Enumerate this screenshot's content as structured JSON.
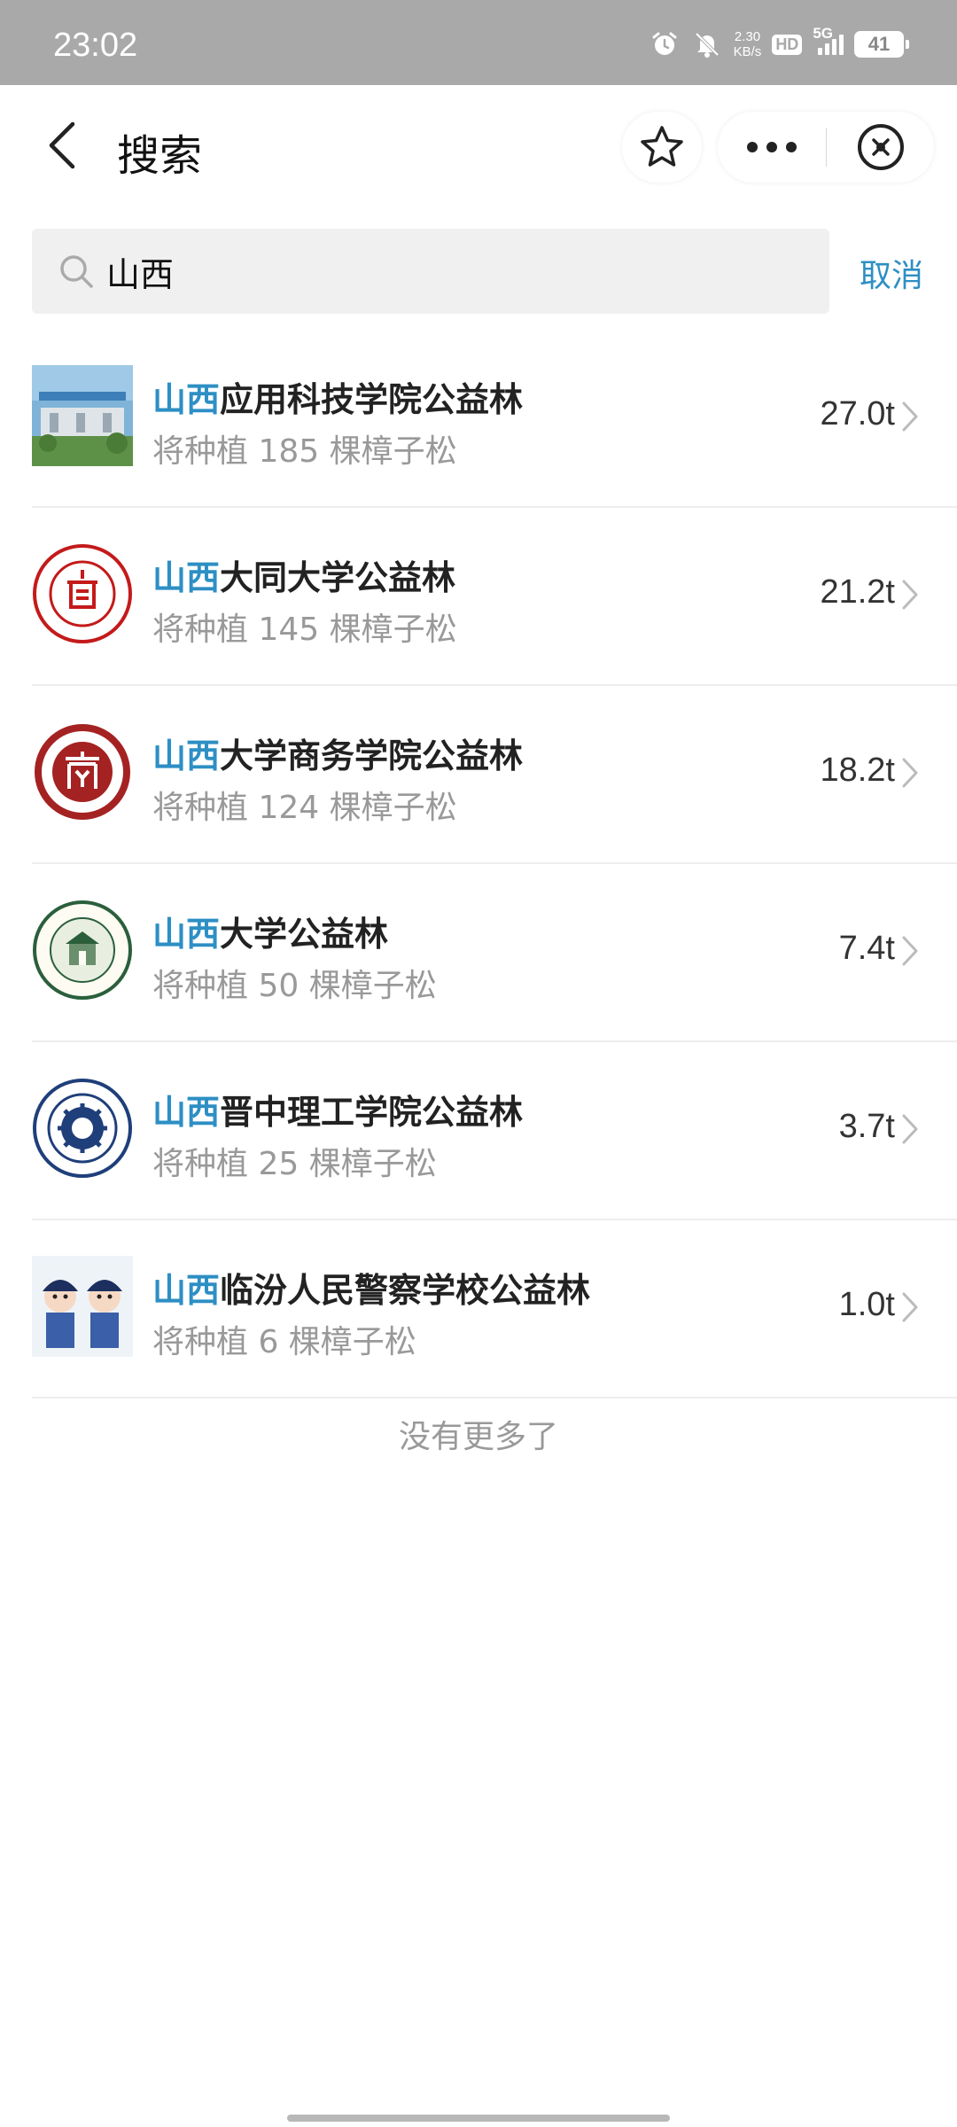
{
  "status_bar": {
    "time": "23:02",
    "net_speed_value": "2.30",
    "net_speed_unit": "KB/s",
    "hd_label": "HD",
    "network": "5G",
    "battery": "41"
  },
  "header": {
    "title": "搜索",
    "back_icon": "chevron-left-icon",
    "favorite_icon": "star-icon",
    "more_icon": "more-dots-icon",
    "close_icon": "close-circle-icon"
  },
  "search": {
    "value": "山西",
    "cancel_label": "取消"
  },
  "colors": {
    "accent": "#2d8fc4",
    "status_bar": "#a9a9a9",
    "secondary_text": "#999999"
  },
  "results": [
    {
      "highlight": "山西",
      "name": "应用科技学院公益林",
      "subtitle": "将种植 185 棵樟子松",
      "value": "27.0t"
    },
    {
      "highlight": "山西",
      "name": "大同大学公益林",
      "subtitle": "将种植 145 棵樟子松",
      "value": "21.2t"
    },
    {
      "highlight": "山西",
      "name": "大学商务学院公益林",
      "subtitle": "将种植 124 棵樟子松",
      "value": "18.2t"
    },
    {
      "highlight": "山西",
      "name": "大学公益林",
      "subtitle": "将种植 50 棵樟子松",
      "value": "7.4t"
    },
    {
      "highlight": "山西",
      "name": "晋中理工学院公益林",
      "subtitle": "将种植 25 棵樟子松",
      "value": "3.7t"
    },
    {
      "highlight": "山西",
      "name": "临汾人民警察学校公益林",
      "subtitle": "将种植 6 棵樟子松",
      "value": "1.0t"
    }
  ],
  "footer": {
    "no_more": "没有更多了"
  }
}
